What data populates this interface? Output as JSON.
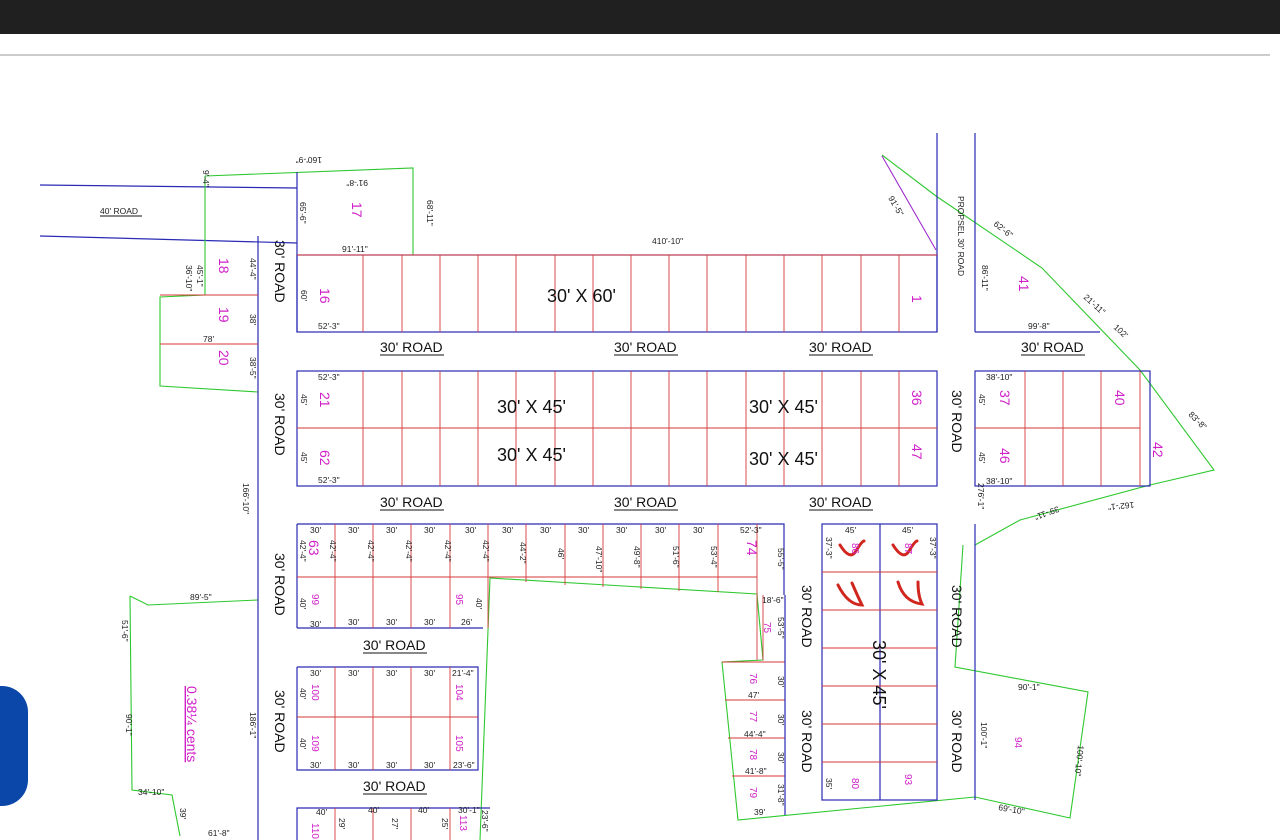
{
  "map": {
    "roads": {
      "forty_road": "40' ROAD",
      "proposed_road": "PROPSEL 30' ROAD",
      "thirty_road": "30' ROAD"
    },
    "plot_sizes": {
      "top_row": "30' X 60'",
      "mid_row": "30' X 45'",
      "center_col": "30' X 45'"
    },
    "area_label": "0.38¼ cents",
    "plots": {
      "p1": "1",
      "p16": "16",
      "p17": "17",
      "p18": "18",
      "p19": "19",
      "p20": "20",
      "p21": "21",
      "p36": "36",
      "p37": "37",
      "p40": "40",
      "p41": "41",
      "p42": "42",
      "p46": "46",
      "p47": "47",
      "p62": "62",
      "p63": "63",
      "p74": "74",
      "p75": "75",
      "p76": "76",
      "p77": "77",
      "p78": "78",
      "p79": "79",
      "p80": "80",
      "p86": "86",
      "p87": "87",
      "p93": "93",
      "p94": "94",
      "p95": "95",
      "p99": "99",
      "p100": "100",
      "p104": "104",
      "p105": "105",
      "p109": "109",
      "p110": "110",
      "p113": "113"
    },
    "dims": {
      "d160_9": "160'-9\"",
      "d91_8": "91'-8\"",
      "d9_4": "9'-4\"",
      "d65_6": "65'-6\"",
      "d68_11": "68'-11\"",
      "d91_11": "91'-11\"",
      "d410_10": "410'-10\"",
      "d91_5": "91'-5\"",
      "d62_6": "62'-6\"",
      "d86_11": "86'-11\"",
      "d21_11": "21'-11\"",
      "d102": "102'",
      "d99_8": "99'-8\"",
      "d45_1": "45'-1\"",
      "d36_10": "36'-10\"",
      "d44_4": "44'-4\"",
      "d60": "60'",
      "d52_3": "52'-3\"",
      "d38": "38'",
      "d78": "78'",
      "d38_5": "38'-5\"",
      "d45": "45'",
      "d38_10": "38'-10\"",
      "d83_8": "83'-8\"",
      "d276_1": "276'-1\"",
      "d39_11": "39'-11\"",
      "d162_1": "162'-1\"",
      "d166_10": "166'-10\"",
      "d30": "30'",
      "d42_4": "42'-4\"",
      "d44_2": "44'-2\"",
      "d46": "46'",
      "d47_10": "47'-10\"",
      "d49_8": "49'-8\"",
      "d51_6": "51'-6\"",
      "d53_4": "53'-4\"",
      "d55_5": "55'-5\"",
      "d37_3": "37'-3\"",
      "d18_6": "18'-6\"",
      "d53_5": "53'-5\"",
      "d89_5": "89'-5\"",
      "d51_6b": "51'-6\"",
      "d40": "40'",
      "d26": "26'",
      "d21_4": "21'-4\"",
      "d47": "47'",
      "d44_4b": "44'-4\"",
      "d41_8": "41'-8\"",
      "d31_8": "31'-8\"",
      "d39": "39'",
      "d35": "35'",
      "d90_1": "90'-1\"",
      "d100_1": "100'-1\"",
      "d100_10": "100'-10\"",
      "d69_10": "69'-10\"",
      "d186_1": "186'-1\"",
      "d90_1b": "90'-1\"",
      "d34_10": "34'-10\"",
      "d61_8": "61'-8\"",
      "d23_6": "23'-6\"",
      "d29": "29'",
      "d27": "27'",
      "d25": "25'",
      "d30_1": "30'-1\"",
      "d23_6b": "23'-6\""
    }
  }
}
